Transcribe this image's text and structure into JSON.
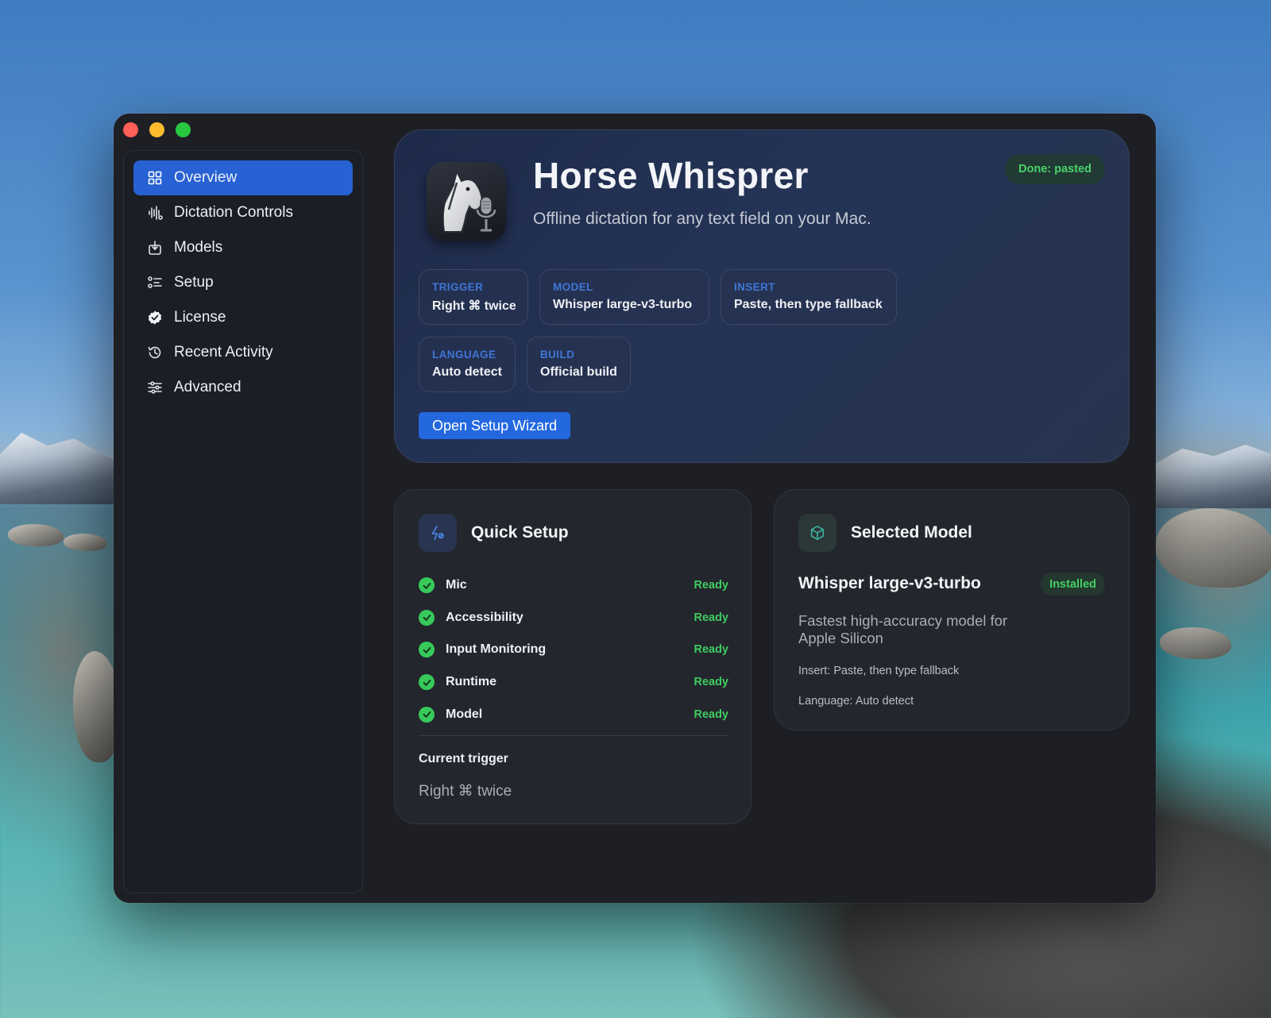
{
  "app": {
    "title": "Horse Whisprer",
    "subtitle": "Offline dictation for any text field on your Mac.",
    "status": "Done: pasted"
  },
  "sidebar": {
    "items": [
      {
        "label": "Overview",
        "icon": "grid-icon",
        "active": true
      },
      {
        "label": "Dictation Controls",
        "icon": "waveform-icon",
        "active": false
      },
      {
        "label": "Models",
        "icon": "download-box-icon",
        "active": false
      },
      {
        "label": "Setup",
        "icon": "checklist-icon",
        "active": false
      },
      {
        "label": "License",
        "icon": "verified-badge-icon",
        "active": false
      },
      {
        "label": "Recent Activity",
        "icon": "history-clock-icon",
        "active": false
      },
      {
        "label": "Advanced",
        "icon": "sliders-icon",
        "active": false
      }
    ]
  },
  "chips": [
    {
      "label": "TRIGGER",
      "value": "Right ⌘ twice"
    },
    {
      "label": "MODEL",
      "value": "Whisper large-v3-turbo"
    },
    {
      "label": "INSERT",
      "value": "Paste, then type fallback"
    },
    {
      "label": "LANGUAGE",
      "value": "Auto detect"
    },
    {
      "label": "BUILD",
      "value": "Official build"
    }
  ],
  "wizard_button": "Open Setup Wizard",
  "quick_setup": {
    "title": "Quick Setup",
    "items": [
      {
        "name": "Mic",
        "state": "Ready"
      },
      {
        "name": "Accessibility",
        "state": "Ready"
      },
      {
        "name": "Input Monitoring",
        "state": "Ready"
      },
      {
        "name": "Runtime",
        "state": "Ready"
      },
      {
        "name": "Model",
        "state": "Ready"
      }
    ],
    "current_trigger_label": "Current trigger",
    "current_trigger_value": "Right ⌘ twice"
  },
  "selected_model": {
    "title": "Selected Model",
    "name": "Whisper large-v3-turbo",
    "badge": "Installed",
    "description": "Fastest high-accuracy model for Apple Silicon",
    "insert": "Insert: Paste, then type fallback",
    "language": "Language: Auto detect"
  },
  "colors": {
    "accent": "#2761d3",
    "ready": "#3fcc5f",
    "chip_label": "#3f76d8"
  }
}
